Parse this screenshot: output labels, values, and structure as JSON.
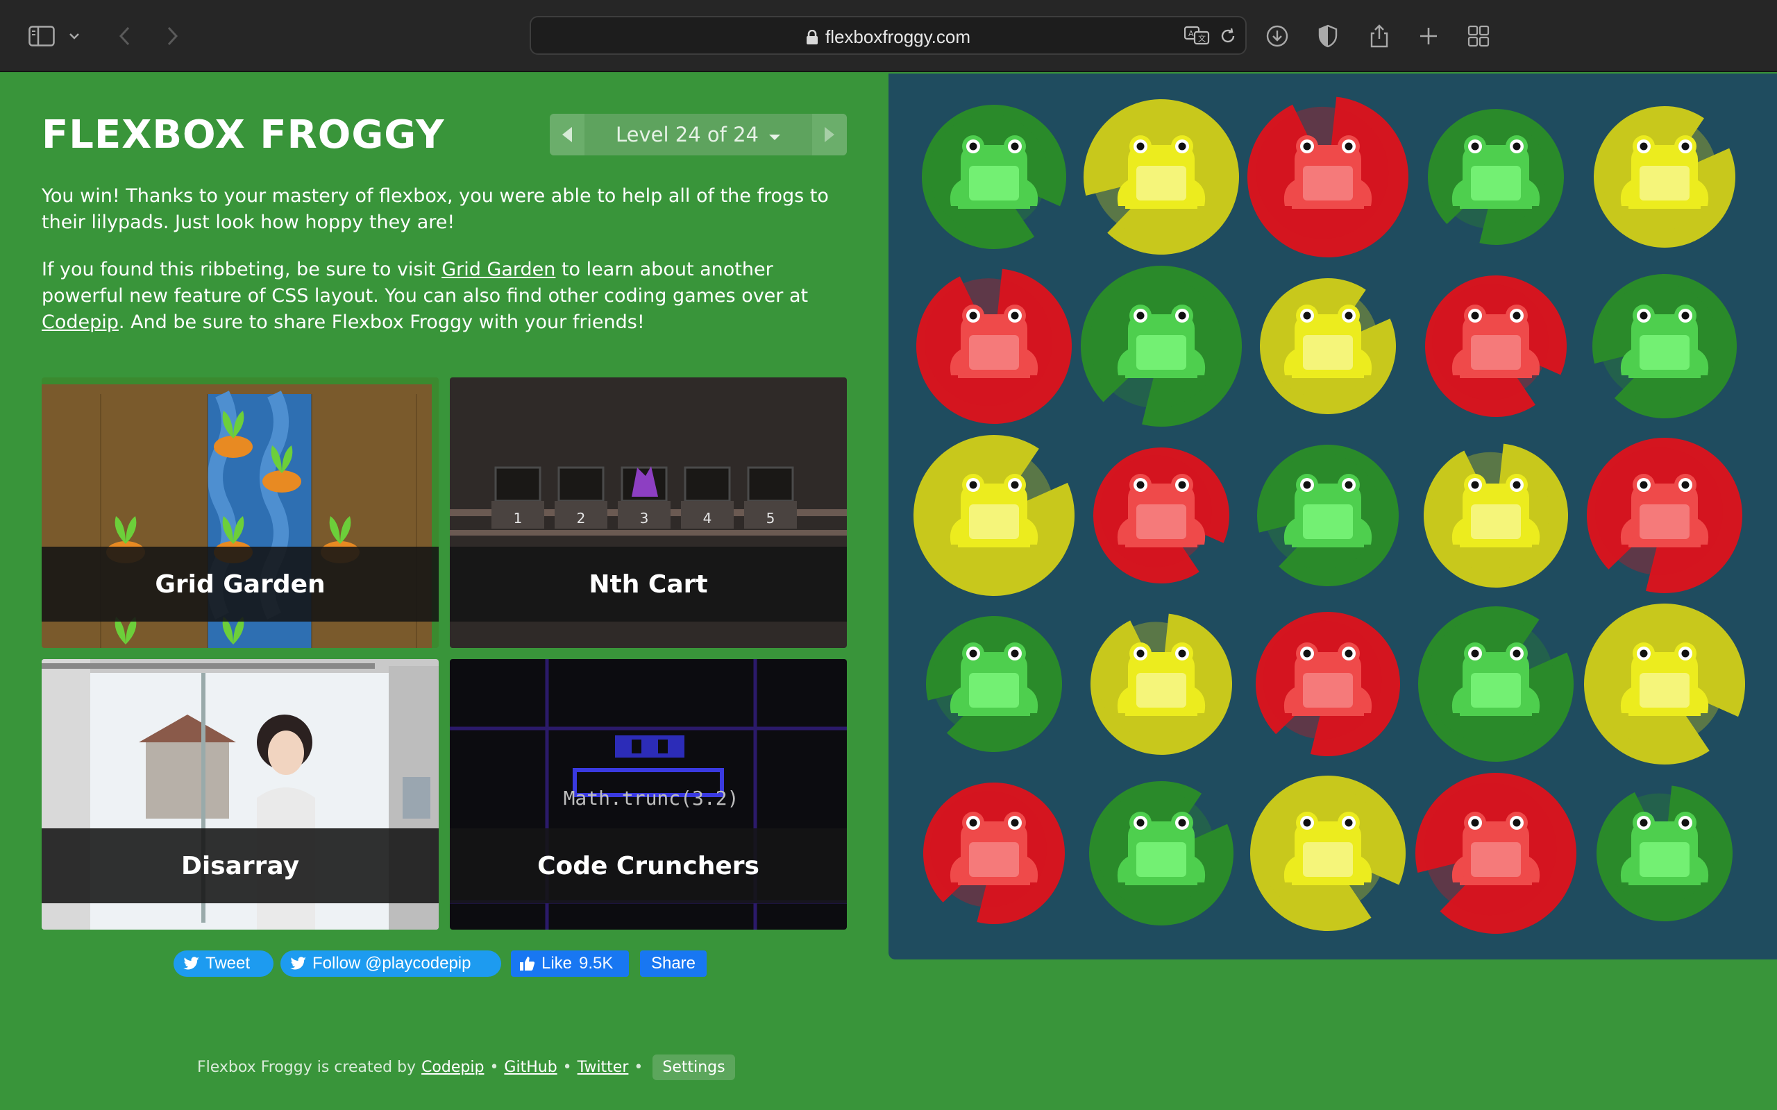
{
  "browser": {
    "url": "flexboxfroggy.com",
    "icons": [
      "sidebar-icon",
      "chevron-down-icon",
      "back-icon",
      "forward-icon",
      "lock-icon",
      "translate-icon",
      "reload-icon",
      "download-icon",
      "shield-icon",
      "share-icon",
      "new-tab-icon",
      "tab-overview-icon"
    ]
  },
  "header": {
    "title": "FLEXBOX FROGGY",
    "level_label": "Level 24 of 24"
  },
  "intro": {
    "p1": "You win! Thanks to your mastery of flexbox, you were able to help all of the frogs to their lilypads. Just look how hoppy they are!",
    "p2_a": "If you found this ribbeting, be sure to visit ",
    "p2_link1": "Grid Garden",
    "p2_b": " to learn about another powerful new feature of CSS layout. You can also find other coding games over at ",
    "p2_link2": "Codepip",
    "p2_c": ". And be sure to share Flexbox Froggy with your friends!"
  },
  "games": [
    {
      "name": "Grid Garden"
    },
    {
      "name": "Nth Cart",
      "cart_numbers": [
        "1",
        "2",
        "3",
        "4",
        "5"
      ]
    },
    {
      "name": "Disarray"
    },
    {
      "name": "Code Crunchers",
      "code": "Math.trunc(3.2)"
    }
  ],
  "social": {
    "tweet": "Tweet",
    "follow": "Follow @playcodepip",
    "like": "Like",
    "like_count": "9.5K",
    "share": "Share"
  },
  "footer": {
    "created_by": "Flexbox Froggy is created by",
    "codepip": "Codepip",
    "github": "GitHub",
    "twitter": "Twitter",
    "settings": "Settings",
    "separator": "•"
  },
  "board": {
    "colors": {
      "green_pad": "#2a8a2a",
      "green_frog": "#4ecf4e",
      "green_belly": "#73f073",
      "yellow_pad": "#c8c81c",
      "yellow_frog": "#ecec1e",
      "yellow_belly": "#f5f57a",
      "red_pad": "#d4151f",
      "red_frog": "#ef4a4a",
      "red_belly": "#f57a7a"
    },
    "rows": [
      [
        "green",
        "yellow",
        "red",
        "green",
        "yellow"
      ],
      [
        "red",
        "green",
        "yellow",
        "red",
        "green"
      ],
      [
        "yellow",
        "red",
        "green",
        "yellow",
        "red"
      ],
      [
        "green",
        "yellow",
        "red",
        "green",
        "yellow"
      ],
      [
        "red",
        "green",
        "yellow",
        "red",
        "green"
      ]
    ]
  }
}
